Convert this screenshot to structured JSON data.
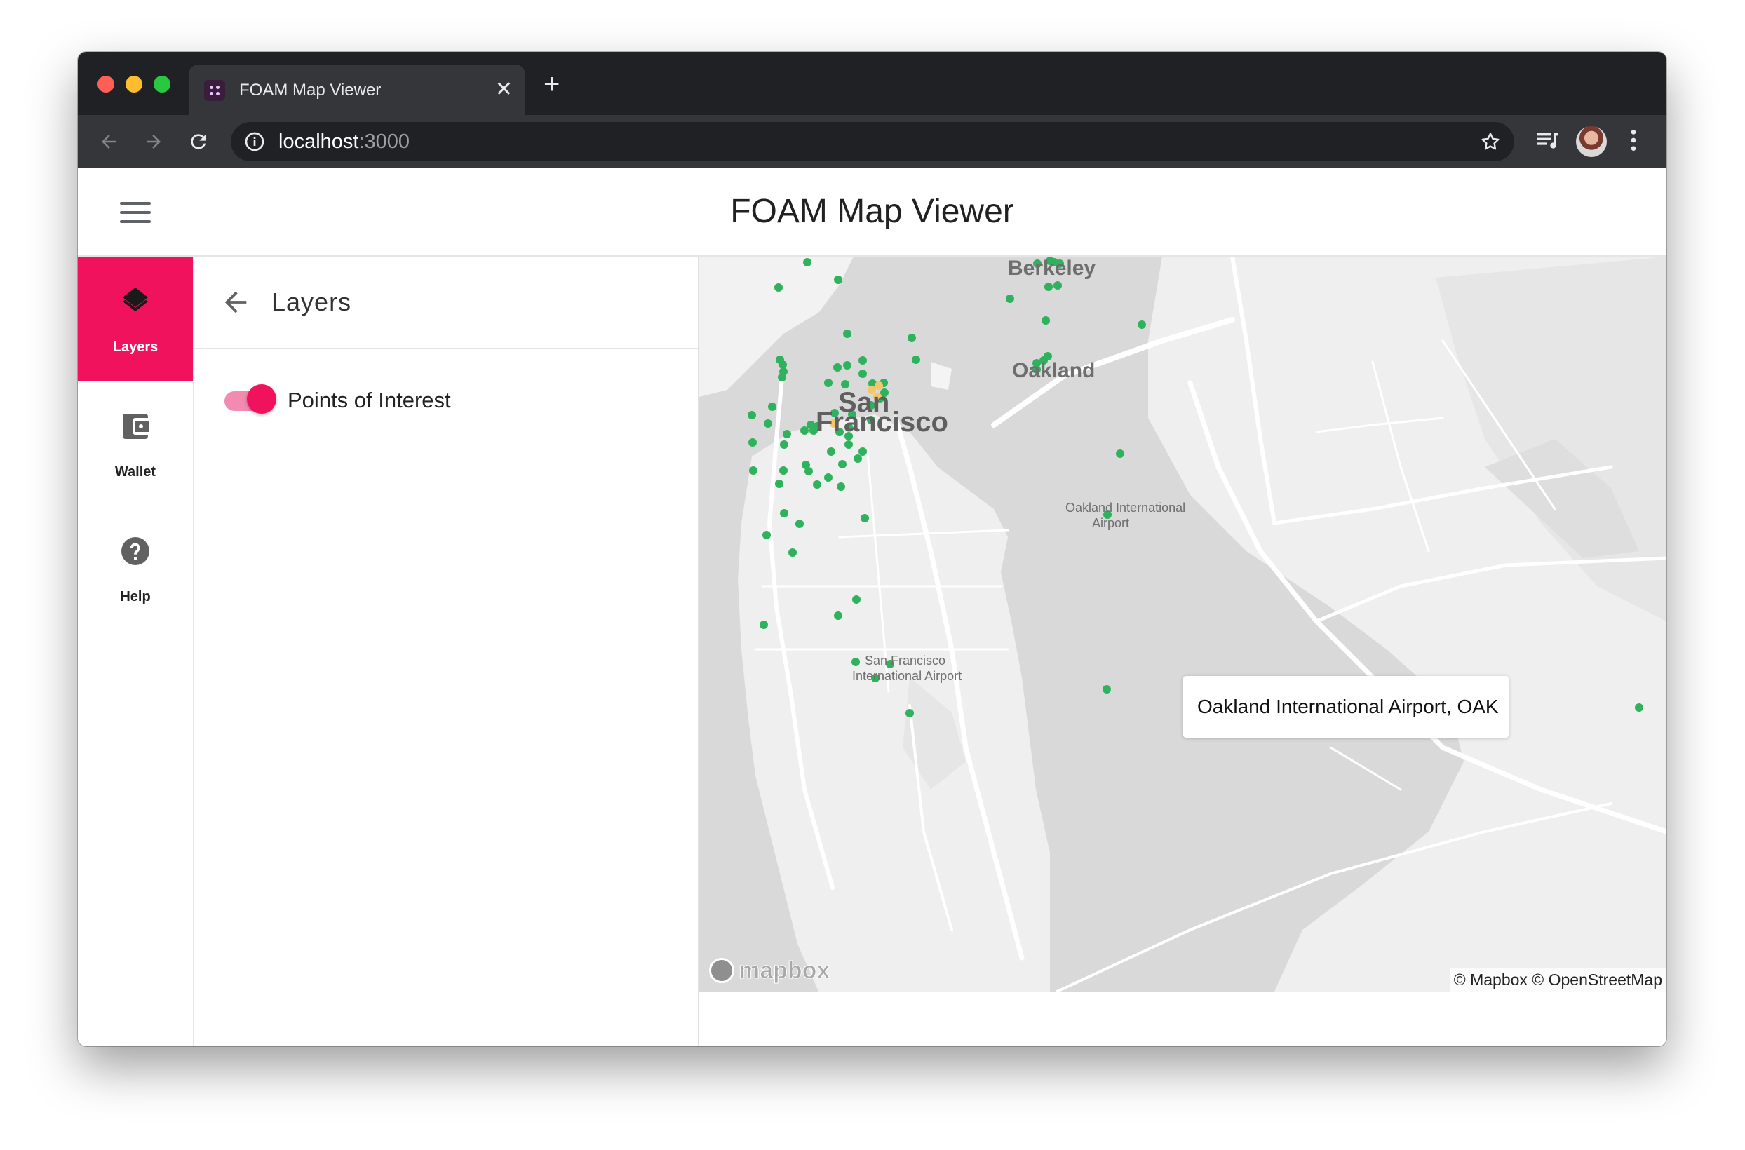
{
  "browser": {
    "tab_title": "FOAM Map Viewer",
    "url_host": "localhost",
    "url_port": ":3000",
    "tab_close": "✕",
    "new_tab": "+"
  },
  "app": {
    "title": "FOAM Map Viewer"
  },
  "sidebar": {
    "items": [
      {
        "label": "Layers",
        "icon": "layers-icon",
        "active": true
      },
      {
        "label": "Wallet",
        "icon": "wallet-icon",
        "active": false
      },
      {
        "label": "Help",
        "icon": "help-icon",
        "active": false
      }
    ]
  },
  "panel": {
    "title": "Layers",
    "layers": [
      {
        "label": "Points of Interest",
        "enabled": true
      }
    ]
  },
  "map": {
    "labels": {
      "berkeley": "Berkeley",
      "oakland": "Oakland",
      "san": "San",
      "francisco": "Francisco",
      "oak_airport": "Oakland International",
      "oak_airport_2": "Airport",
      "sfo_1": "San Francisco",
      "sfo_2": "International Airport"
    },
    "tooltip": "Oakland International Airport, OAK",
    "attribution": "© Mapbox © OpenStreetMap",
    "logo": "mapbox",
    "colors": {
      "poi_marker": "#2fb25d",
      "poi_marker_pending": "#f5c66a",
      "accent": "#f0125c"
    }
  }
}
